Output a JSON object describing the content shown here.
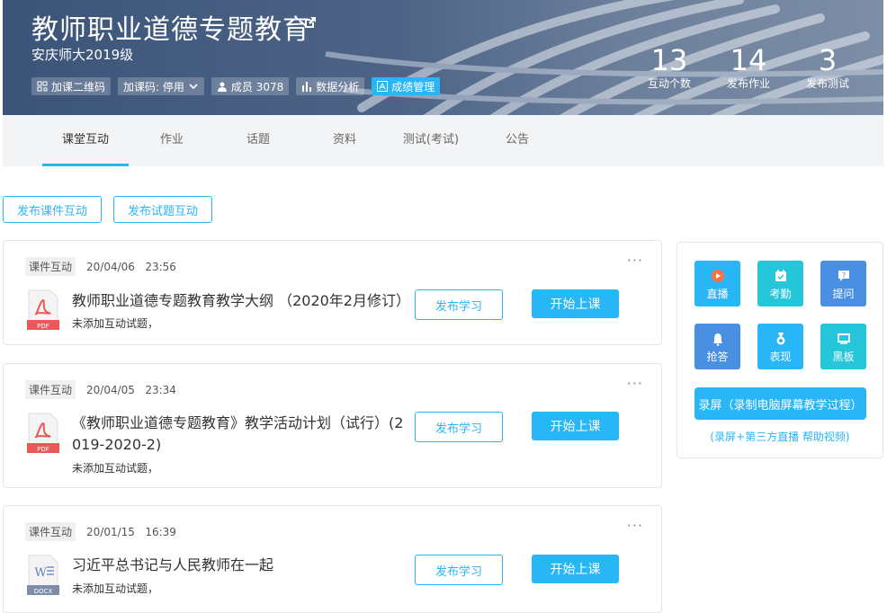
{
  "header": {
    "title": "教师职业道德专题教育",
    "subtitle": "安庆师大2019级",
    "chips": [
      {
        "label": "加课二维码",
        "icon": "qrcode-icon"
      },
      {
        "label": "加课码: 停用",
        "icon": "chevron-down-icon"
      },
      {
        "label": "成员 3078",
        "icon": "user-icon"
      },
      {
        "label": "数据分析",
        "icon": "bar-chart-icon"
      },
      {
        "label": "成绩管理",
        "icon": "grade-icon"
      }
    ],
    "stats": [
      {
        "num": "13",
        "label": "互动个数"
      },
      {
        "num": "14",
        "label": "发布作业"
      },
      {
        "num": "3",
        "label": "发布测试"
      }
    ]
  },
  "tabs": [
    "课堂互动",
    "作业",
    "话题",
    "资料",
    "测试(考试)",
    "公告"
  ],
  "actions": {
    "publish_courseware": "发布课件互动",
    "publish_question": "发布试题互动"
  },
  "cards": [
    {
      "badge": "课件互动",
      "date": "20/04/06",
      "time": "23:56",
      "file_type": "PDF",
      "title": "教师职业道德专题教育教学大纲 （2020年2月修订）",
      "note": "未添加互动试题，",
      "publish": "发布学习",
      "start": "开始上课"
    },
    {
      "badge": "课件互动",
      "date": "20/04/05",
      "time": "23:34",
      "file_type": "PDF",
      "title_line1": "《教师职业道德专题教育》教学活动计划（试行）(2",
      "title_line2": "019-2020-2)",
      "note": "未添加互动试题，",
      "publish": "发布学习",
      "start": "开始上课"
    },
    {
      "badge": "课件互动",
      "date": "20/01/15",
      "time": "16:39",
      "file_type": "DOCX",
      "title": "习近平总书记与人民教师在一起",
      "note": "未添加互动试题，",
      "publish": "发布学习",
      "start": "开始上课"
    }
  ],
  "panel": {
    "tools": [
      {
        "label": "直播",
        "icon": "live-icon",
        "color": "#29b6f6"
      },
      {
        "label": "考勤",
        "icon": "attendance-icon",
        "color": "#26c6da"
      },
      {
        "label": "提问",
        "icon": "question-icon",
        "color": "#4a90e2"
      },
      {
        "label": "抢答",
        "icon": "bell-icon",
        "color": "#4a90e2"
      },
      {
        "label": "表现",
        "icon": "medal-icon",
        "color": "#29b6f6"
      },
      {
        "label": "黑板",
        "icon": "blackboard-icon",
        "color": "#26c6da"
      }
    ],
    "record_label": "录屏（录制电脑屏幕教学过程）",
    "record_help": "(录屏+第三方直播 帮助视频)"
  }
}
